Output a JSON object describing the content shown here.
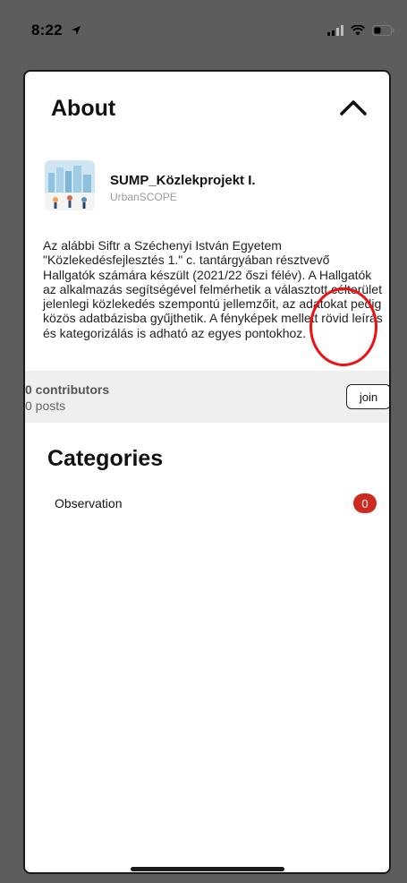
{
  "status_bar": {
    "time": "8:22",
    "icons": [
      "location-arrow-icon",
      "signal-icon",
      "wifi-icon",
      "battery-icon"
    ]
  },
  "about": {
    "title": "About",
    "collapse_icon": "chevron-up-icon"
  },
  "project": {
    "name": "SUMP_Közlekprojekt I.",
    "organization": "UrbanSCOPE",
    "description": "Az alábbi Siftr a Széchenyi István Egyetem \"Közlekedésfejlesztés 1.\" c. tantárgyában résztvevő Hallgatók számára készült (2021/22 őszi félév). A Hallgatók az alkalmazás segítségével felmérhetik a választott célterület jelenlegi közlekedés szempontú jellemzőit, az adatokat pedig közös adatbázisba gyűjthetik. A fényképek mellett rövid leírás és kategorizálás is adható az egyes pontokhoz."
  },
  "stats": {
    "contributors": "0 contributors",
    "posts": "0 posts",
    "join_label": "join"
  },
  "categories": {
    "title": "Categories",
    "items": [
      {
        "label": "Observation",
        "count": "0",
        "color": "#cc2a1f"
      }
    ]
  },
  "annotation": {
    "color": "#ee1111"
  }
}
